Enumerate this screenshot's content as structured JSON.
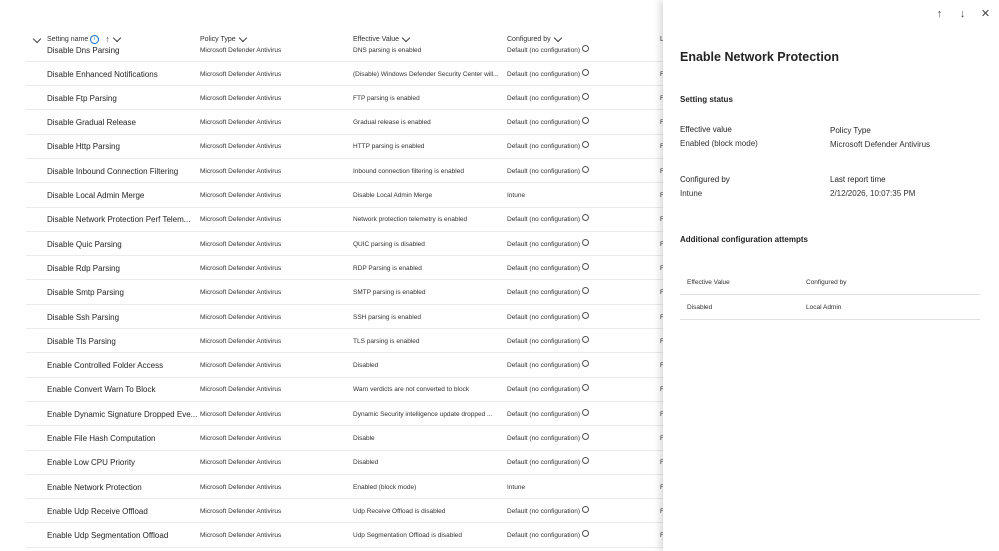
{
  "grid": {
    "headers": {
      "setting_name": "Setting name",
      "policy_type": "Policy Type",
      "effective_value": "Effective Value",
      "configured_by": "Configured by",
      "last": "L"
    },
    "partial_row": {
      "name": "Disable Dns Parsing",
      "type": "Microsoft Defender Antivirus",
      "value": "DNS parsing is enabled",
      "configured": "Default (no configuration)"
    },
    "rows": [
      {
        "name": "Disable Enhanced Notifications",
        "type": "Microsoft Defender Antivirus",
        "value": "(Disable) Windows Defender Security Center will...",
        "configured": "Default (no configuration)",
        "info": true,
        "last": "F"
      },
      {
        "name": "Disable Ftp Parsing",
        "type": "Microsoft Defender Antivirus",
        "value": "FTP parsing is enabled",
        "configured": "Default (no configuration)",
        "info": true,
        "last": "F"
      },
      {
        "name": "Disable Gradual Release",
        "type": "Microsoft Defender Antivirus",
        "value": "Gradual release is enabled",
        "configured": "Default (no configuration)",
        "info": true,
        "last": "F"
      },
      {
        "name": "Disable Http Parsing",
        "type": "Microsoft Defender Antivirus",
        "value": "HTTP parsing is enabled",
        "configured": "Default (no configuration)",
        "info": true,
        "last": "F"
      },
      {
        "name": "Disable Inbound Connection Filtering",
        "type": "Microsoft Defender Antivirus",
        "value": "Inbound connection filtering is enabled",
        "configured": "Default (no configuration)",
        "info": true,
        "last": "F"
      },
      {
        "name": "Disable Local Admin Merge",
        "type": "Microsoft Defender Antivirus",
        "value": "Disable Local Admin Merge",
        "configured": "Intune",
        "info": false,
        "last": "F"
      },
      {
        "name": "Disable Network Protection Perf Telem...",
        "type": "Microsoft Defender Antivirus",
        "value": "Network protection telemetry is enabled",
        "configured": "Default (no configuration)",
        "info": true,
        "last": "F"
      },
      {
        "name": "Disable Quic Parsing",
        "type": "Microsoft Defender Antivirus",
        "value": "QUIC parsing is disabled",
        "configured": "Default (no configuration)",
        "info": true,
        "last": "F"
      },
      {
        "name": "Disable Rdp Parsing",
        "type": "Microsoft Defender Antivirus",
        "value": "RDP Parsing is enabled",
        "configured": "Default (no configuration)",
        "info": true,
        "last": "F"
      },
      {
        "name": "Disable Smtp Parsing",
        "type": "Microsoft Defender Antivirus",
        "value": "SMTP parsing is enabled",
        "configured": "Default (no configuration)",
        "info": true,
        "last": "F"
      },
      {
        "name": "Disable Ssh Parsing",
        "type": "Microsoft Defender Antivirus",
        "value": "SSH parsing is enabled",
        "configured": "Default (no configuration)",
        "info": true,
        "last": "F"
      },
      {
        "name": "Disable Tls Parsing",
        "type": "Microsoft Defender Antivirus",
        "value": "TLS parsing is enabled",
        "configured": "Default (no configuration)",
        "info": true,
        "last": "F"
      },
      {
        "name": "Enable Controlled Folder Access",
        "type": "Microsoft Defender Antivirus",
        "value": "Disabled",
        "configured": "Default (no configuration)",
        "info": true,
        "last": "F"
      },
      {
        "name": "Enable Convert Warn To Block",
        "type": "Microsoft Defender Antivirus",
        "value": "Warn verdicts are not converted to block",
        "configured": "Default (no configuration)",
        "info": true,
        "last": "F"
      },
      {
        "name": "Enable Dynamic Signature Dropped Eve...",
        "type": "Microsoft Defender Antivirus",
        "value": "Dynamic Security intelligence update dropped ...",
        "configured": "Default (no configuration)",
        "info": true,
        "last": "F"
      },
      {
        "name": "Enable File Hash Computation",
        "type": "Microsoft Defender Antivirus",
        "value": "Disable",
        "configured": "Default (no configuration)",
        "info": true,
        "last": "F"
      },
      {
        "name": "Enable Low CPU Priority",
        "type": "Microsoft Defender Antivirus",
        "value": "Disabled",
        "configured": "Default (no configuration)",
        "info": true,
        "last": "F"
      },
      {
        "name": "Enable Network Protection",
        "type": "Microsoft Defender Antivirus",
        "value": "Enabled (block mode)",
        "configured": "Intune",
        "info": false,
        "last": "F"
      },
      {
        "name": "Enable Udp Receive Offload",
        "type": "Microsoft Defender Antivirus",
        "value": "Udp Receive Offload is disabled",
        "configured": "Default (no configuration)",
        "info": true,
        "last": "F"
      },
      {
        "name": "Enable Udp Segmentation Offload",
        "type": "Microsoft Defender Antivirus",
        "value": "Udp Segmentation Offload is disabled",
        "configured": "Default (no configuration)",
        "info": true,
        "last": "F"
      }
    ]
  },
  "panel": {
    "title": "Enable Network Protection",
    "setting_status": "Setting status",
    "effective_value_label": "Effective value",
    "effective_value": "Enabled (block mode)",
    "policy_type_label": "Policy Type",
    "policy_type": "Microsoft Defender Antivirus",
    "configured_by_label": "Configured by",
    "configured_by": "Intune",
    "last_report_label": "Last report time",
    "last_report": "2/12/2026, 10:07:35 PM",
    "additional_title": "Additional configuration attempts",
    "attempts_headers": {
      "effective": "Effective Value",
      "configured": "Configured by"
    },
    "attempts": [
      {
        "effective": "Disabled",
        "configured": "Local Admin"
      }
    ],
    "icons": [
      "arrow-up-icon",
      "arrow-down-icon",
      "close-icon"
    ]
  }
}
